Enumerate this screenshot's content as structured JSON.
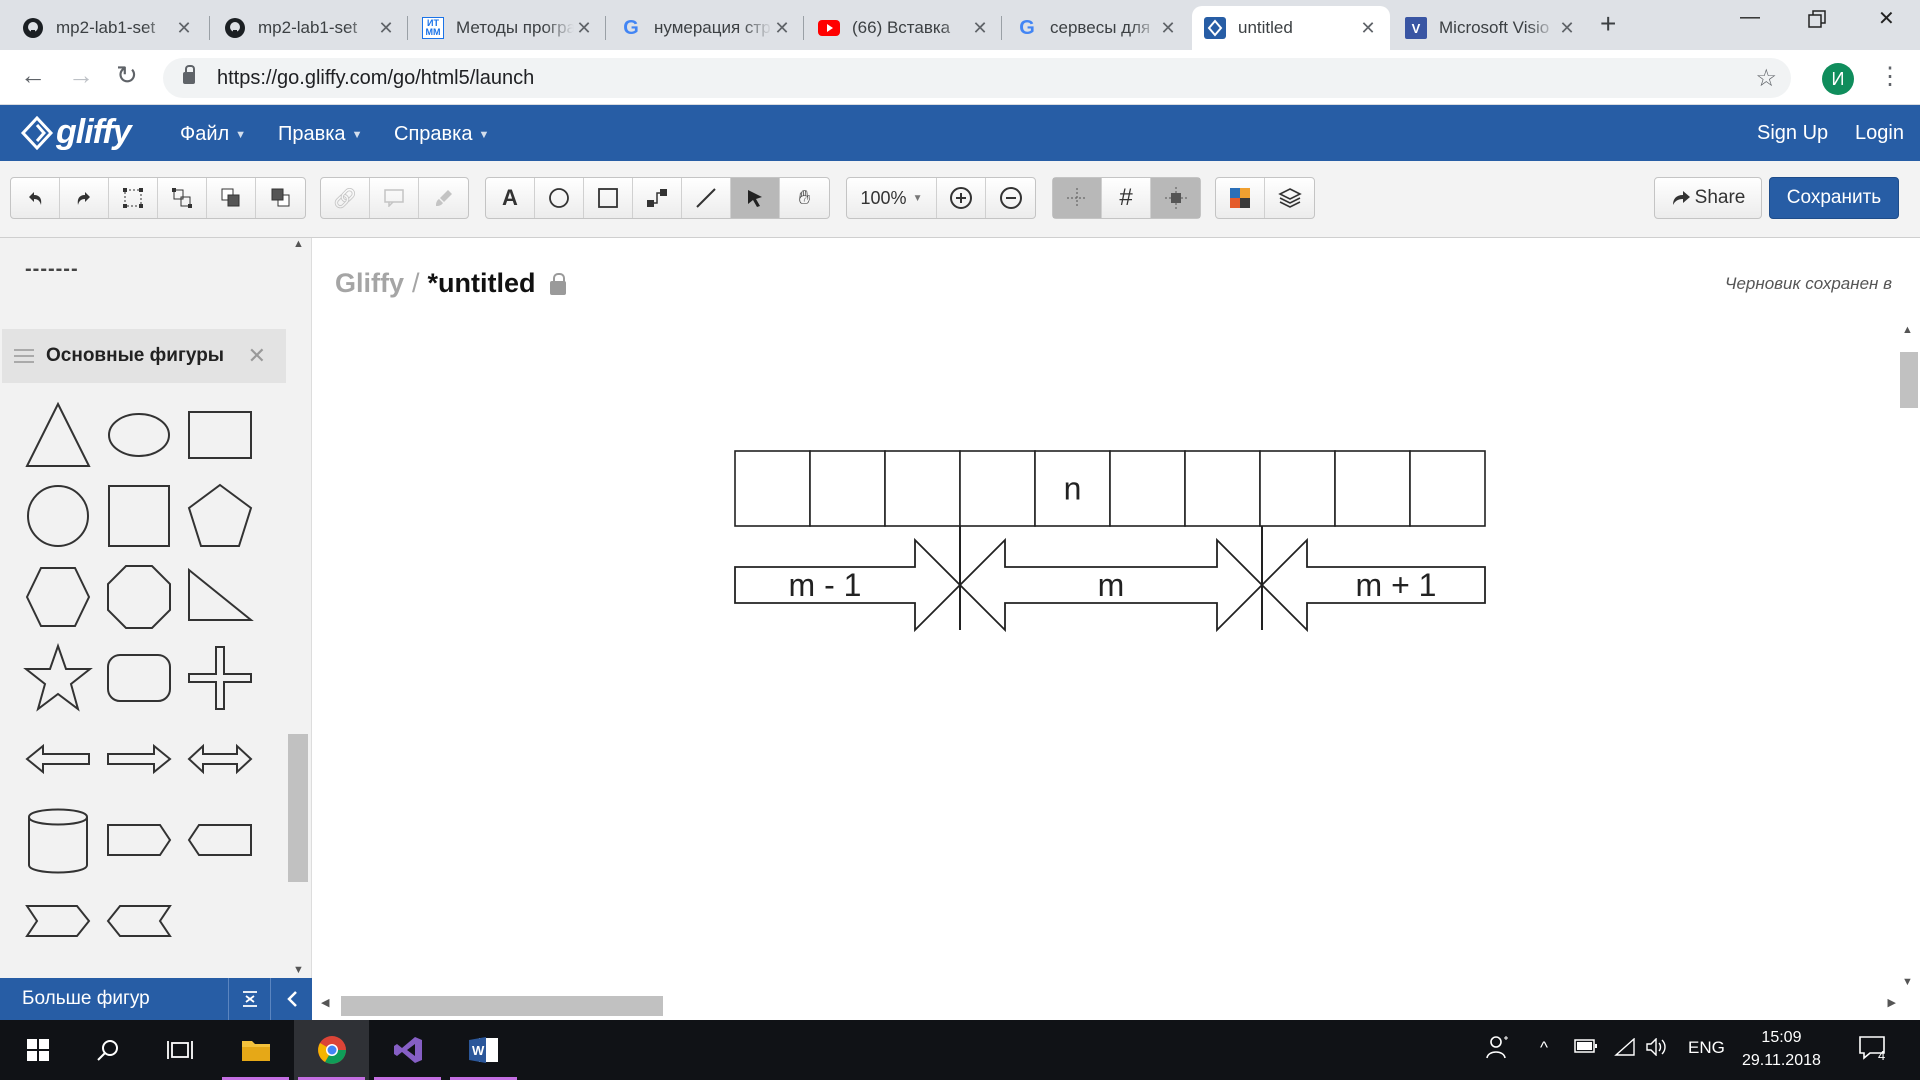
{
  "browser": {
    "tabs": [
      {
        "title": "mp2-lab1-set",
        "icon": "github-icon",
        "active": false
      },
      {
        "title": "mp2-lab1-set",
        "icon": "github-icon",
        "active": false
      },
      {
        "title": "Методы программирования",
        "icon": "itmm-icon",
        "active": false
      },
      {
        "title": "нумерация страниц",
        "icon": "google-icon",
        "active": false
      },
      {
        "title": "(66) Вставка",
        "icon": "youtube-icon",
        "active": false
      },
      {
        "title": "сервесы для",
        "icon": "google-icon",
        "active": false
      },
      {
        "title": "untitled",
        "icon": "gliffy-icon",
        "active": true
      },
      {
        "title": "Microsoft Visio",
        "icon": "visio-icon",
        "active": false
      }
    ],
    "url": "https://go.gliffy.com/go/html5/launch",
    "profile_initial": "И"
  },
  "app": {
    "logo_text": "gliffy",
    "menu": [
      {
        "label": "Файл"
      },
      {
        "label": "Правка"
      },
      {
        "label": "Справка"
      }
    ],
    "sign_up": "Sign Up",
    "login": "Login",
    "brand_color": "#275da5"
  },
  "toolbar": {
    "zoom": "100%",
    "share_label": "Share",
    "save_label": "Сохранить"
  },
  "sidebar": {
    "line_sample": "-------",
    "section_title": "Основные фигуры",
    "shapes": [
      "triangle",
      "ellipse",
      "rectangle",
      "circle",
      "square",
      "pentagon",
      "hexagon",
      "octagon",
      "right-triangle",
      "star",
      "rounded-rectangle",
      "cross",
      "left-arrow",
      "right-arrow",
      "double-arrow",
      "cylinder",
      "tag-right",
      "tag-left",
      "chevron",
      "chevron-left"
    ],
    "more_shapes_label": "Больше фигур"
  },
  "canvas": {
    "breadcrumb_root": "Gliffy",
    "breadcrumb_sep": "/",
    "doc_title": "*untitled",
    "draft_note": "Черновик сохранен в",
    "diagram": {
      "cells": [
        "",
        "",
        "",
        "",
        "n",
        "",
        "",
        "",
        "",
        ""
      ],
      "arrow_labels": [
        "m - 1",
        "m",
        "m + 1"
      ]
    }
  },
  "taskbar": {
    "language": "ENG",
    "time": "15:09",
    "date": "29.11.2018",
    "notifications": "4"
  }
}
